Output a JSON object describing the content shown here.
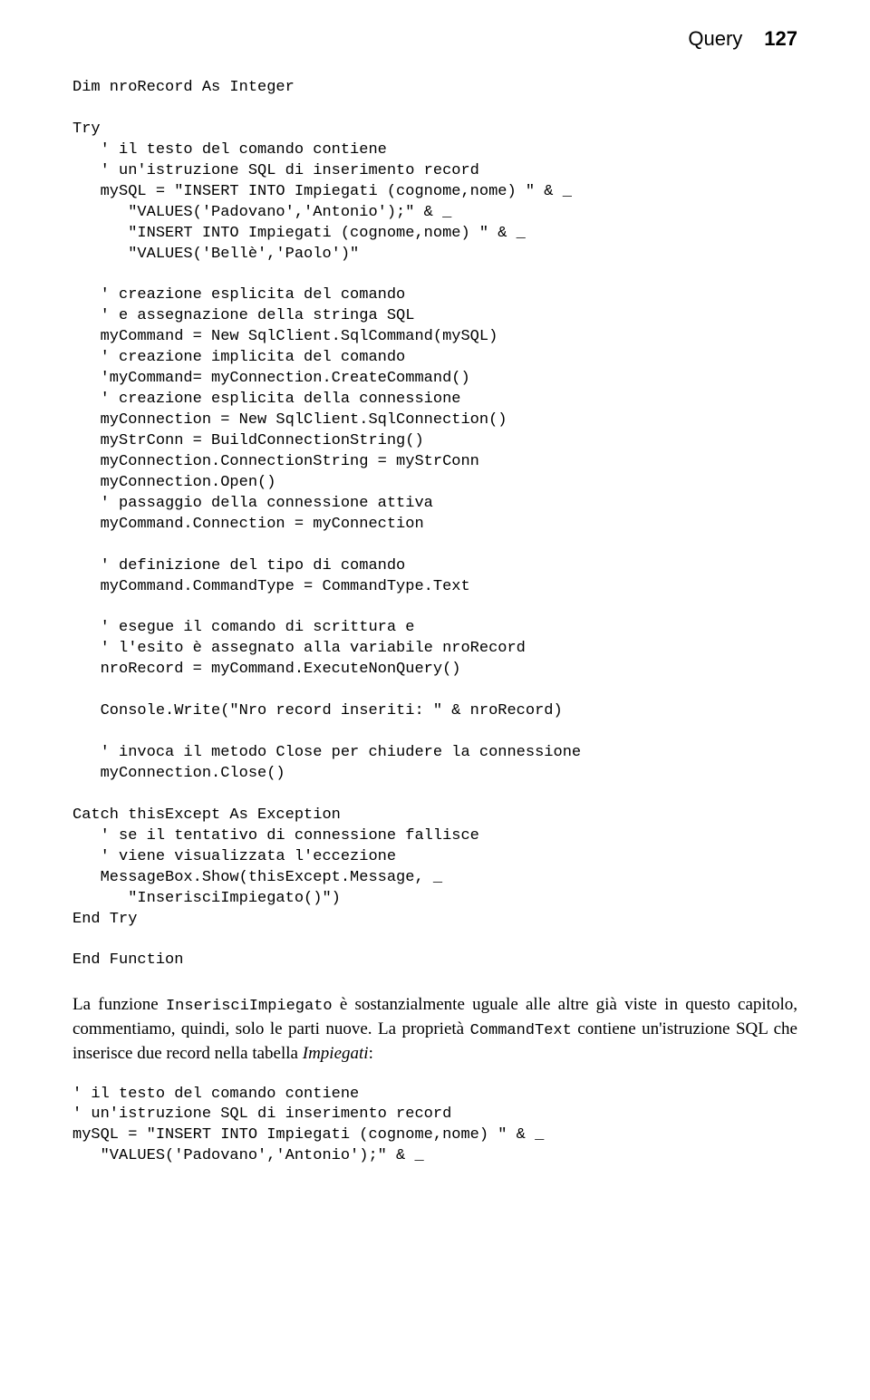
{
  "header": {
    "title": "Query",
    "page": "127"
  },
  "code1": "Dim nroRecord As Integer\n\nTry\n   ' il testo del comando contiene\n   ' un'istruzione SQL di inserimento record\n   mySQL = \"INSERT INTO Impiegati (cognome,nome) \" & _\n      \"VALUES('Padovano','Antonio');\" & _\n      \"INSERT INTO Impiegati (cognome,nome) \" & _\n      \"VALUES('Bellè','Paolo')\"\n\n   ' creazione esplicita del comando\n   ' e assegnazione della stringa SQL\n   myCommand = New SqlClient.SqlCommand(mySQL)\n   ' creazione implicita del comando\n   'myCommand= myConnection.CreateCommand()\n   ' creazione esplicita della connessione\n   myConnection = New SqlClient.SqlConnection()\n   myStrConn = BuildConnectionString()\n   myConnection.ConnectionString = myStrConn\n   myConnection.Open()\n   ' passaggio della connessione attiva\n   myCommand.Connection = myConnection\n\n   ' definizione del tipo di comando\n   myCommand.CommandType = CommandType.Text\n\n   ' esegue il comando di scrittura e\n   ' l'esito è assegnato alla variabile nroRecord\n   nroRecord = myCommand.ExecuteNonQuery()\n\n   Console.Write(\"Nro record inseriti: \" & nroRecord)\n\n   ' invoca il metodo Close per chiudere la connessione\n   myConnection.Close()\n\nCatch thisExcept As Exception\n   ' se il tentativo di connessione fallisce\n   ' viene visualizzata l'eccezione\n   MessageBox.Show(thisExcept.Message, _\n      \"InserisciImpiegato()\")\nEnd Try\n\nEnd Function",
  "paragraph": {
    "t1": "La funzione ",
    "m1": "InserisciImpiegato",
    "t2": " è sostanzialmente uguale alle altre già viste in questo capitolo, commentiamo, quindi, solo le parti nuove. La proprietà ",
    "m2": "CommandText",
    "t3": " contiene un'istruzione SQL che inserisce due record nella tabella ",
    "i1": "Impiegati",
    "t4": ":"
  },
  "code2": "' il testo del comando contiene\n' un'istruzione SQL di inserimento record\nmySQL = \"INSERT INTO Impiegati (cognome,nome) \" & _\n   \"VALUES('Padovano','Antonio');\" & _"
}
